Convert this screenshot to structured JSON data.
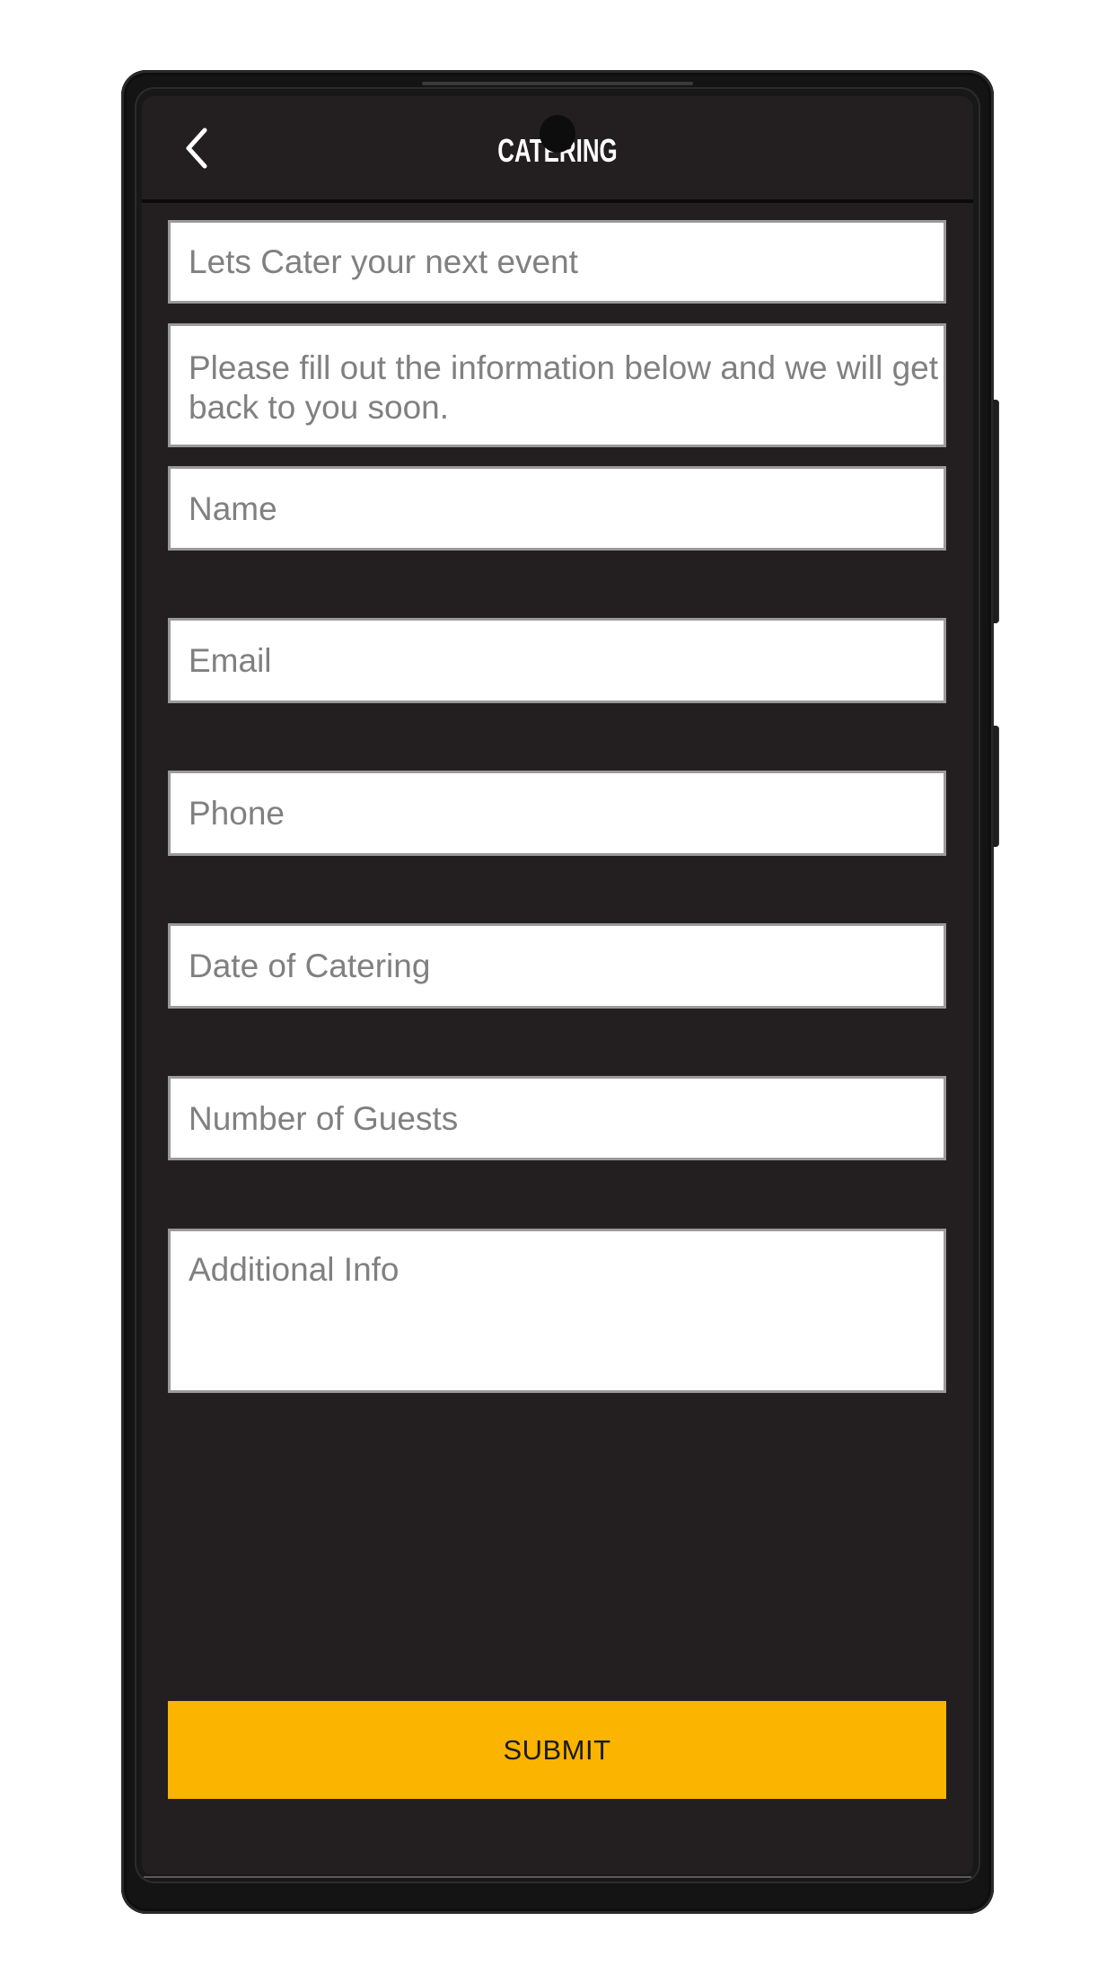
{
  "header": {
    "title": "CATERING",
    "back_icon": "chevron-left-icon"
  },
  "form": {
    "intro_heading": "Lets Cater your next event",
    "intro_text": "Please fill out the information below and we will get back to you soon.",
    "fields": {
      "name": {
        "placeholder": "Name",
        "value": ""
      },
      "email": {
        "placeholder": "Email",
        "value": ""
      },
      "phone": {
        "placeholder": "Phone",
        "value": ""
      },
      "date": {
        "placeholder": "Date of Catering",
        "value": ""
      },
      "guests": {
        "placeholder": "Number of Guests",
        "value": ""
      },
      "additional_info": {
        "placeholder": "Additional Info",
        "value": ""
      }
    },
    "submit_label": "SUBMIT"
  },
  "colors": {
    "accent": "#fbb400",
    "background": "#231f20",
    "placeholder_text": "#808080",
    "title_text": "#ffffff"
  }
}
